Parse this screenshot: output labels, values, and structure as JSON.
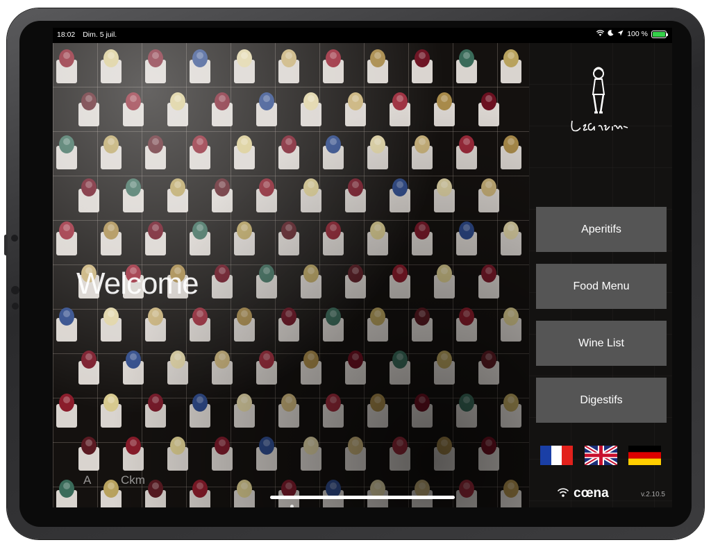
{
  "status_bar": {
    "time": "18:02",
    "date": "Dim. 5 juil.",
    "battery_percent": "100 %",
    "battery_level": 1.0,
    "icons": [
      "wifi-icon",
      "moon-icon",
      "location-icon",
      "battery-icon"
    ]
  },
  "welcome": {
    "title": "Welcome"
  },
  "watermark": {
    "a": "A",
    "ckm": "Ckm"
  },
  "brand": {
    "logo_text": "Le Gavroche"
  },
  "menu": {
    "items": [
      {
        "label": "Aperitifs"
      },
      {
        "label": "Food Menu"
      },
      {
        "label": "Wine List"
      },
      {
        "label": "Digestifs"
      }
    ]
  },
  "languages": [
    {
      "name": "french-flag-icon"
    },
    {
      "name": "uk-flag-icon"
    },
    {
      "name": "german-flag-icon"
    }
  ],
  "footer": {
    "brand": "cœna",
    "version": "v.2.10.5"
  },
  "colors": {
    "button_bg": "#555555",
    "battery_green": "#35d14a",
    "sidebar_bg": "#2a2826"
  }
}
